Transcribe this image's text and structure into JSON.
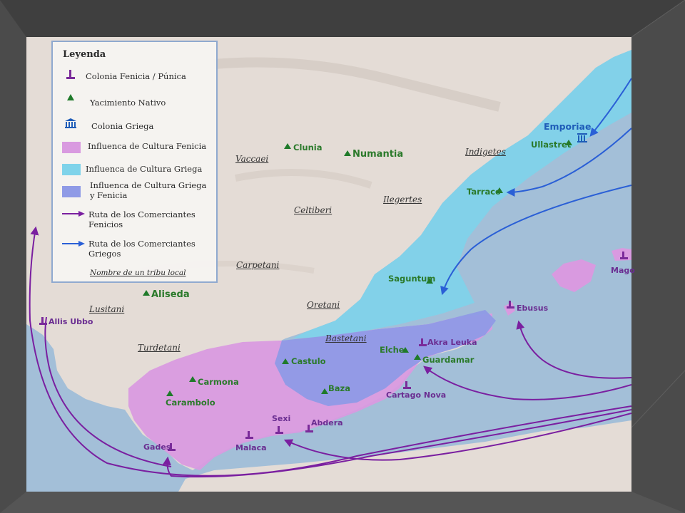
{
  "legend": {
    "title": "Leyenda",
    "items": [
      {
        "symbol": "phoenician-colony",
        "label": "Colonia Fenicia / Púnica",
        "color": "#7a2a9a"
      },
      {
        "symbol": "native-site",
        "label": "Yacimiento Nativo",
        "color": "#1f7a2a"
      },
      {
        "symbol": "greek-colony",
        "label": "Colonia Griega",
        "color": "#1e5cb8"
      },
      {
        "symbol": "phoenician-influence",
        "label": "Influenca de Cultura Fenicia",
        "color": "#d99ae0"
      },
      {
        "symbol": "greek-influence",
        "label": "Influenca de Cultura Griega",
        "color": "#7fd3ea"
      },
      {
        "symbol": "mixed-influence",
        "label": "Influenca de Cultura Griega\ny Fenicia",
        "color": "#8f9ae6"
      },
      {
        "symbol": "phoenician-route",
        "label": "Ruta de los Comerciantes\nFenicios",
        "color": "#7a1fa0"
      },
      {
        "symbol": "greek-route",
        "label": "Ruta de los Comerciantes\nGriegos",
        "color": "#2a5fd6"
      }
    ],
    "note": "Nombre de un tribu local"
  },
  "greek_colonies": [
    "Emporiae"
  ],
  "phoenician_colonies": [
    "Allis Ubbo",
    "Akra Leuka",
    "Ebusus",
    "Mago",
    "Cartago Nova",
    "Sexi",
    "Abdera",
    "Malaca",
    "Gades"
  ],
  "native_sites": [
    "Clunia",
    "Numantia",
    "Ullastret",
    "Tarraco",
    "Saguntum",
    "Aliseda",
    "Elche",
    "Guardamar",
    "Castulo",
    "Baza",
    "Carmona",
    "Carambolo"
  ],
  "tribes": [
    "Vaccaei",
    "Indigetes",
    "Celtiberi",
    "Ilegertes",
    "Carpetani",
    "Oretani",
    "Lusitani",
    "Bastetani",
    "Turdetani"
  ],
  "colors": {
    "land": "#e4dcd6",
    "sea": "#a3bfd8",
    "phoenician": "#d99ae0",
    "greek": "#7fd3ea",
    "mixed": "#8f9ae6",
    "native": "#1f7a2a",
    "purple": "#7a2a9a",
    "blue": "#1e5cb8"
  }
}
